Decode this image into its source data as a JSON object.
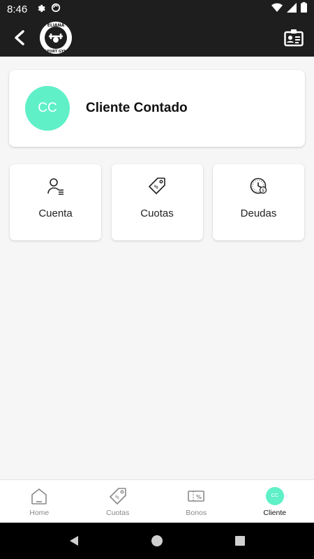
{
  "status_bar": {
    "time": "8:46"
  },
  "app_bar": {
    "logo_text_top": "ELIANA",
    "logo_text_bottom": "SPORT GYM"
  },
  "client": {
    "initials": "CC",
    "name": "Cliente Contado",
    "avatar_color": "#5ff0c8"
  },
  "tiles": [
    {
      "label": "Cuenta",
      "icon": "user-list-icon"
    },
    {
      "label": "Cuotas",
      "icon": "price-tag-icon"
    },
    {
      "label": "Deudas",
      "icon": "clock-debt-icon"
    }
  ],
  "bottom_nav": {
    "items": [
      {
        "label": "Home",
        "icon": "home-icon"
      },
      {
        "label": "Cuotas",
        "icon": "price-tag-icon"
      },
      {
        "label": "Bonos",
        "icon": "voucher-icon"
      },
      {
        "label": "Cliente",
        "icon": "avatar",
        "active": true,
        "initials": "CC"
      }
    ]
  },
  "colors": {
    "accent": "#5ff0c8",
    "bar_bg": "#1e1e1e"
  }
}
